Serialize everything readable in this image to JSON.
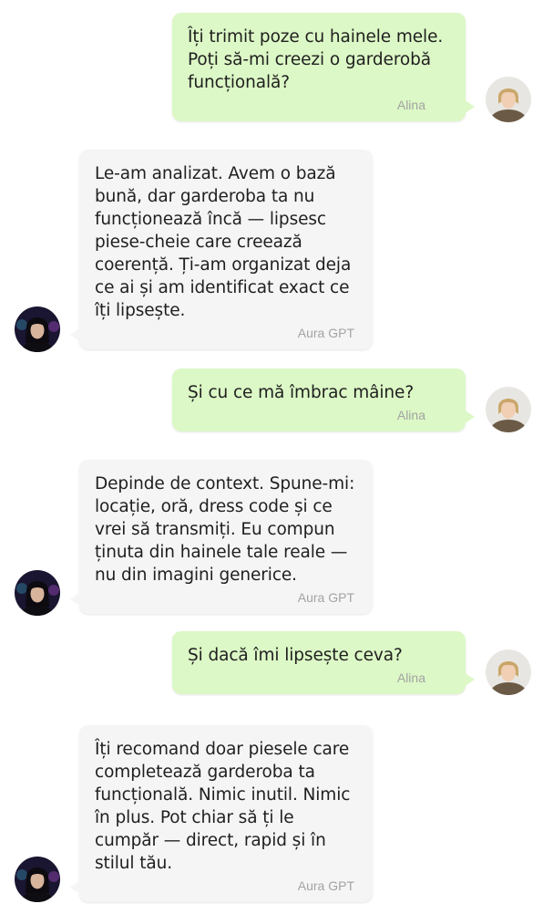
{
  "conversation": {
    "messages": [
      {
        "role": "user",
        "text": "Îți trimit poze cu hainele mele.\nPoți să-mi creezi o garderobă\nfuncțională?",
        "sender": "Alina",
        "avatar_icon": "user-avatar-photo"
      },
      {
        "role": "bot",
        "text": "Le-am analizat. Avem o bază\nbună, dar garderoba ta nu\nfuncționează încă — lipsesc\npiese-cheie care creează\ncoerență. Ți-am organizat deja\nce ai și am identificat exact ce\nîți lipsește.",
        "sender": "Aura GPT",
        "avatar_icon": "bot-avatar-photo"
      },
      {
        "role": "user",
        "text": "Și cu ce mă îmbrac mâine?",
        "sender": "Alina",
        "avatar_icon": "user-avatar-photo"
      },
      {
        "role": "bot",
        "text": "Depinde de context. Spune-mi:\nlocație, oră, dress code și ce\nvrei să transmiți. Eu compun\nținuta din hainele tale reale —\nnu din imagini generice.",
        "sender": "Aura GPT",
        "avatar_icon": "bot-avatar-photo"
      },
      {
        "role": "user",
        "text": "Și dacă îmi lipsește ceva?",
        "sender": "Alina",
        "avatar_icon": "user-avatar-photo"
      },
      {
        "role": "bot",
        "text": "Îți recomand doar piesele care\ncompletează garderoba ta\nfuncțională. Nimic inutil. Nimic\nîn plus. Pot chiar să ți le\ncumpăr — direct, rapid și în\nstilul tău.",
        "sender": "Aura GPT",
        "avatar_icon": "bot-avatar-photo"
      }
    ]
  },
  "colors": {
    "user_bubble": "#dcf8c6",
    "bot_bubble": "#f5f5f5",
    "sender_text": "#a3a3a3",
    "message_text": "#1f1f1f"
  }
}
